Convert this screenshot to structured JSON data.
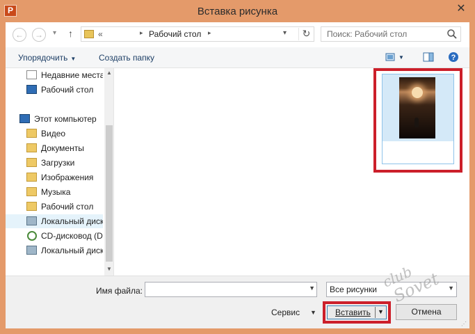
{
  "window": {
    "title": "Вставка рисунка",
    "app_icon": "P",
    "close_glyph": "✕"
  },
  "navigation": {
    "back_icon": "back-arrow-icon",
    "forward_icon": "forward-arrow-icon",
    "up_icon": "up-arrow-icon",
    "address": {
      "overflow": "«",
      "location": "Рабочий стол",
      "separator": "▸"
    },
    "search_placeholder": "Поиск: Рабочий стол"
  },
  "toolbar": {
    "organize_label": "Упорядочить",
    "new_folder_label": "Создать папку"
  },
  "sidebar": {
    "items": [
      {
        "label": "Недавние места",
        "icon": "recent-places-icon"
      },
      {
        "label": "Рабочий стол",
        "icon": "desktop-icon"
      },
      {
        "label": "Этот компьютер",
        "icon": "computer-icon"
      },
      {
        "label": "Видео",
        "icon": "video-folder-icon"
      },
      {
        "label": "Документы",
        "icon": "documents-folder-icon"
      },
      {
        "label": "Загрузки",
        "icon": "downloads-folder-icon"
      },
      {
        "label": "Изображения",
        "icon": "pictures-folder-icon"
      },
      {
        "label": "Музыка",
        "icon": "music-folder-icon"
      },
      {
        "label": "Рабочий стол",
        "icon": "desktop-folder-icon"
      },
      {
        "label": "Локальный диск",
        "icon": "local-disk-icon"
      },
      {
        "label": "CD-дисковод (D:",
        "icon": "cd-drive-icon"
      },
      {
        "label": "Локальный диск",
        "icon": "local-disk-icon"
      }
    ]
  },
  "bottom": {
    "filename_label": "Имя файла:",
    "filename_value": "",
    "filter_value": "Все рисунки",
    "tools_label": "Сервис",
    "insert_label": "Вставить",
    "cancel_label": "Отмена"
  },
  "colors": {
    "accent_border": "#cc1f2a",
    "titlebar": "#e49a6a"
  }
}
